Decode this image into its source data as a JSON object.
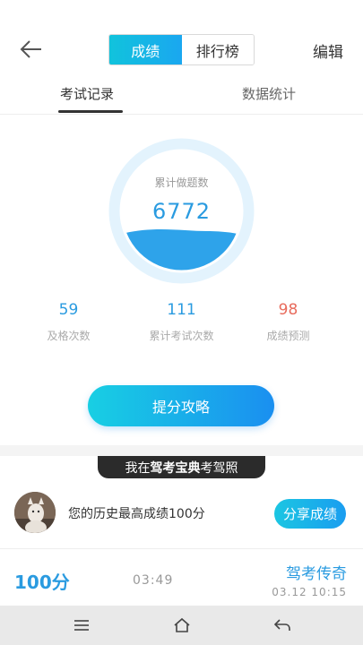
{
  "header": {
    "segments": [
      "成绩",
      "排行榜"
    ],
    "active_segment": 0,
    "edit_label": "编辑"
  },
  "tabs": [
    {
      "label": "考试记录",
      "active": true
    },
    {
      "label": "数据统计",
      "active": false
    }
  ],
  "gauge": {
    "label": "累计做题数",
    "value": "6772"
  },
  "stats": [
    {
      "value": "59",
      "label": "及格次数"
    },
    {
      "value": "111",
      "label": "累计考试次数"
    },
    {
      "value": "98",
      "label": "成绩预测"
    }
  ],
  "cta_label": "提分攻略",
  "banner": {
    "prefix": "我在",
    "brand": "驾考宝典",
    "suffix": "考驾照"
  },
  "share": {
    "text": "您的历史最高成绩100分",
    "button_label": "分享成绩"
  },
  "record": {
    "score": "100分",
    "duration": "03:49",
    "title": "驾考传奇",
    "date": "03.12 10:15"
  },
  "colors": {
    "accent": "#1a9df0",
    "stat_red": "#e86b5c",
    "banner_bg": "#2b2b2b"
  }
}
